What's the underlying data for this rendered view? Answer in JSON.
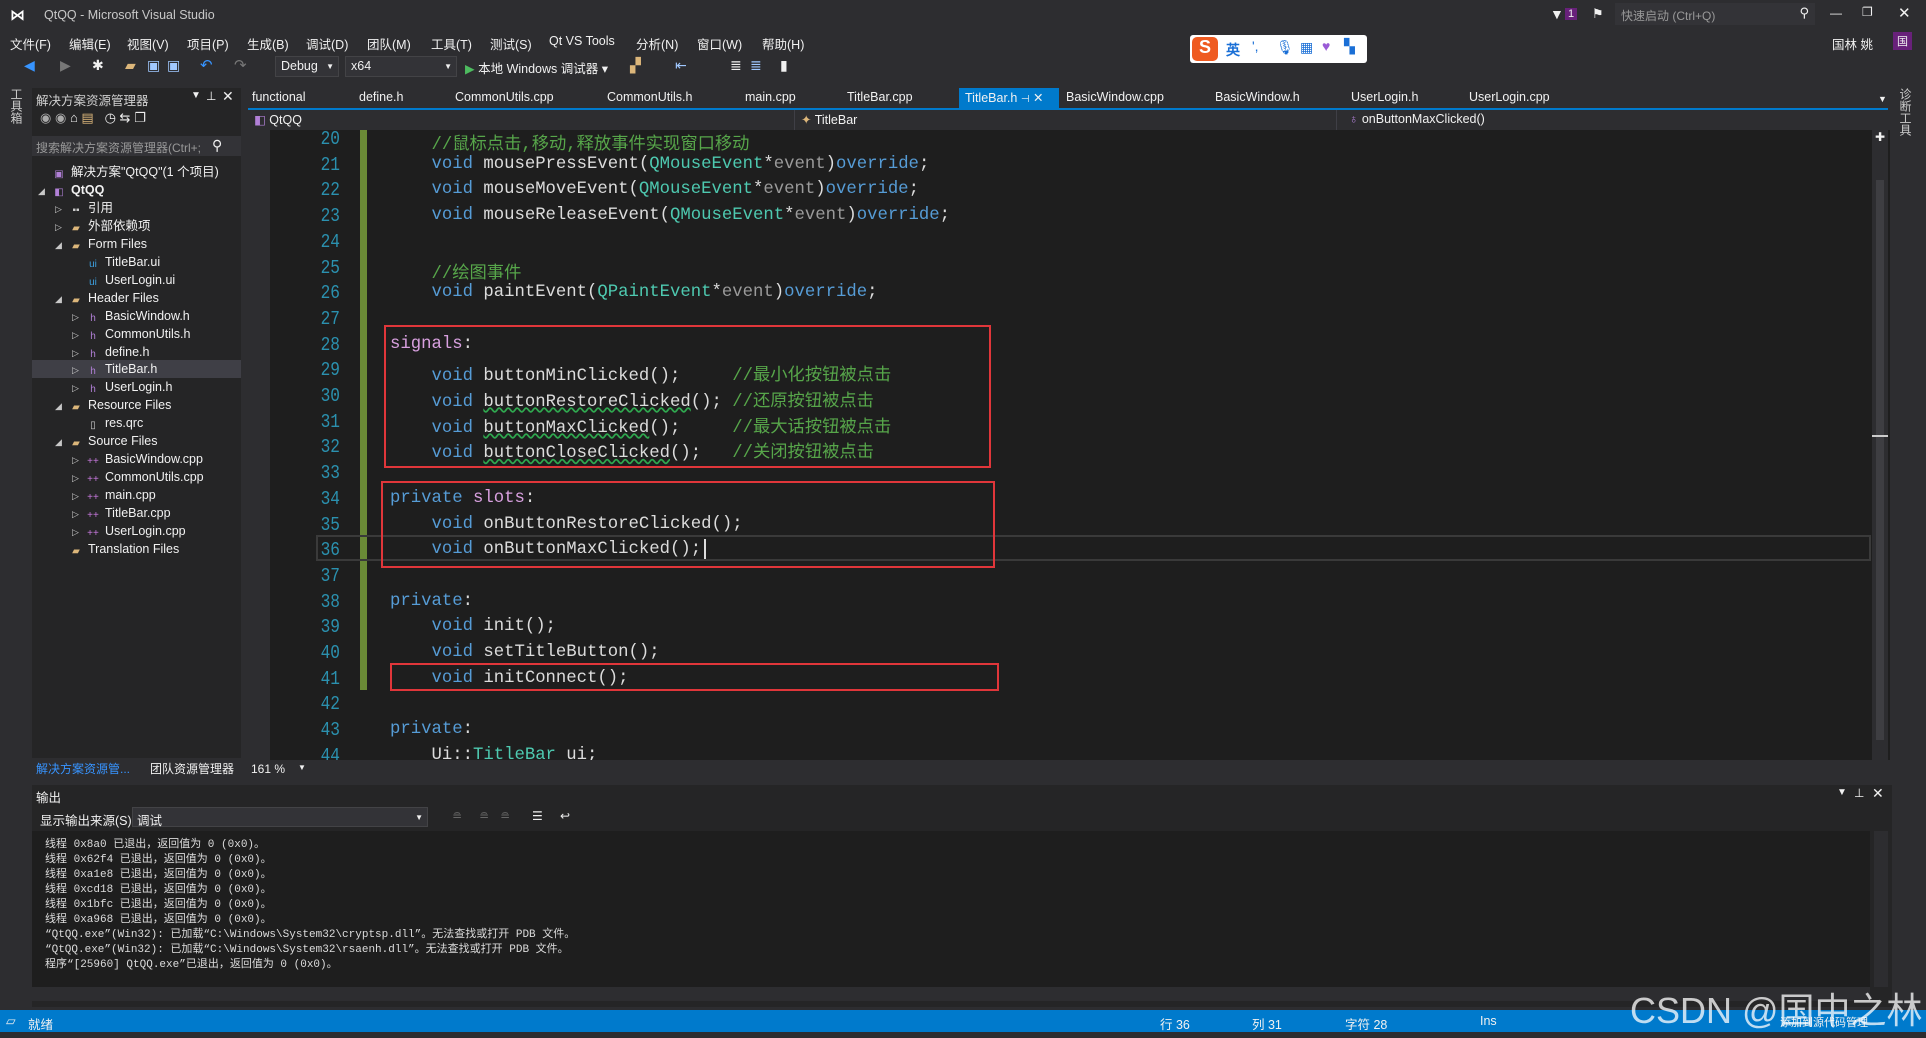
{
  "window": {
    "title": "QtQQ - Microsoft Visual Studio",
    "quick_launch": "快速启动 (Ctrl+Q)",
    "notif_count": "1",
    "user": "国林 姚",
    "user_initial": "国"
  },
  "menu": [
    "文件(F)",
    "编辑(E)",
    "视图(V)",
    "项目(P)",
    "生成(B)",
    "调试(D)",
    "团队(M)",
    "工具(T)",
    "测试(S)",
    "Qt VS Tools",
    "分析(N)",
    "窗口(W)",
    "帮助(H)"
  ],
  "toolbar": {
    "config": "Debug",
    "platform": "x64",
    "run_label": "本地 Windows 调试器"
  },
  "ime": {
    "lang": "英"
  },
  "tabs": [
    "functional",
    "define.h",
    "CommonUtils.cpp",
    "CommonUtils.h",
    "main.cpp",
    "TitleBar.cpp",
    "TitleBar.h",
    "BasicWindow.cpp",
    "BasicWindow.h",
    "UserLogin.h",
    "UserLogin.cpp"
  ],
  "active_tab": "TitleBar.h",
  "navbar": {
    "project": "QtQQ",
    "class": "TitleBar",
    "member": "onButtonMaxClicked()"
  },
  "solution_explorer": {
    "title": "解决方案资源管理器",
    "search_placeholder": "搜索解决方案资源管理器(Ctrl+;",
    "tree": [
      {
        "label": "解决方案\"QtQQ\"(1 个项目)",
        "level": 0,
        "expander": "",
        "icon": "solution"
      },
      {
        "label": "QtQQ",
        "level": 0,
        "expander": "open",
        "icon": "project",
        "bold": true
      },
      {
        "label": "引用",
        "level": 1,
        "expander": "closed",
        "icon": "references"
      },
      {
        "label": "外部依赖项",
        "level": 1,
        "expander": "closed",
        "icon": "folder"
      },
      {
        "label": "Form Files",
        "level": 1,
        "expander": "open",
        "icon": "filter"
      },
      {
        "label": "TitleBar.ui",
        "level": 2,
        "expander": "",
        "icon": "ui"
      },
      {
        "label": "UserLogin.ui",
        "level": 2,
        "expander": "",
        "icon": "ui"
      },
      {
        "label": "Header Files",
        "level": 1,
        "expander": "open",
        "icon": "filter"
      },
      {
        "label": "BasicWindow.h",
        "level": 2,
        "expander": "closed",
        "icon": "h"
      },
      {
        "label": "CommonUtils.h",
        "level": 2,
        "expander": "closed",
        "icon": "h"
      },
      {
        "label": "define.h",
        "level": 2,
        "expander": "closed",
        "icon": "h"
      },
      {
        "label": "TitleBar.h",
        "level": 2,
        "expander": "closed",
        "icon": "h",
        "selected": true
      },
      {
        "label": "UserLogin.h",
        "level": 2,
        "expander": "closed",
        "icon": "h"
      },
      {
        "label": "Resource Files",
        "level": 1,
        "expander": "open",
        "icon": "filter"
      },
      {
        "label": "res.qrc",
        "level": 2,
        "expander": "",
        "icon": "file"
      },
      {
        "label": "Source Files",
        "level": 1,
        "expander": "open",
        "icon": "filter"
      },
      {
        "label": "BasicWindow.cpp",
        "level": 2,
        "expander": "closed",
        "icon": "cpp"
      },
      {
        "label": "CommonUtils.cpp",
        "level": 2,
        "expander": "closed",
        "icon": "cpp"
      },
      {
        "label": "main.cpp",
        "level": 2,
        "expander": "closed",
        "icon": "cpp"
      },
      {
        "label": "TitleBar.cpp",
        "level": 2,
        "expander": "closed",
        "icon": "cpp"
      },
      {
        "label": "UserLogin.cpp",
        "level": 2,
        "expander": "closed",
        "icon": "cpp"
      },
      {
        "label": "Translation Files",
        "level": 1,
        "expander": "",
        "icon": "filter"
      }
    ],
    "bottom_tabs": [
      "解决方案资源管...",
      "团队资源管理器"
    ]
  },
  "left_strip": "工具箱",
  "right_strip": "诊断工具",
  "editor": {
    "zoom": "161 %",
    "first_line": 20,
    "lines": [
      [
        [
          "    ",
          ""
        ],
        [
          "//鼠标点击,移动,释放事件实现窗口移动",
          "cm"
        ]
      ],
      [
        [
          "    ",
          ""
        ],
        [
          "void",
          "kw"
        ],
        [
          " mousePressEvent(",
          ""
        ],
        [
          "QMouseEvent",
          "ty"
        ],
        [
          "*",
          ""
        ],
        [
          "event",
          "pa"
        ],
        [
          ")",
          ""
        ],
        [
          "override",
          "kw"
        ],
        [
          ";",
          ""
        ]
      ],
      [
        [
          "    ",
          ""
        ],
        [
          "void",
          "kw"
        ],
        [
          " mouseMoveEvent(",
          ""
        ],
        [
          "QMouseEvent",
          "ty"
        ],
        [
          "*",
          ""
        ],
        [
          "event",
          "pa"
        ],
        [
          ")",
          ""
        ],
        [
          "override",
          "kw"
        ],
        [
          ";",
          ""
        ]
      ],
      [
        [
          "    ",
          ""
        ],
        [
          "void",
          "kw"
        ],
        [
          " mouseReleaseEvent(",
          ""
        ],
        [
          "QMouseEvent",
          "ty"
        ],
        [
          "*",
          ""
        ],
        [
          "event",
          "pa"
        ],
        [
          ")",
          ""
        ],
        [
          "override",
          "kw"
        ],
        [
          ";",
          ""
        ]
      ],
      [],
      [
        [
          "    ",
          ""
        ],
        [
          "//绘图事件",
          "cm"
        ]
      ],
      [
        [
          "    ",
          ""
        ],
        [
          "void",
          "kw"
        ],
        [
          " paintEvent(",
          ""
        ],
        [
          "QPaintEvent",
          "ty"
        ],
        [
          "*",
          ""
        ],
        [
          "event",
          "pa"
        ],
        [
          ")",
          ""
        ],
        [
          "override",
          "kw"
        ],
        [
          ";",
          ""
        ]
      ],
      [],
      [
        [
          "signals",
          "pp"
        ],
        [
          ":",
          ""
        ]
      ],
      [
        [
          "    ",
          ""
        ],
        [
          "void",
          "kw"
        ],
        [
          " buttonMinClicked();     ",
          ""
        ],
        [
          "//最小化按钮被点击",
          "cm"
        ]
      ],
      [
        [
          "    ",
          ""
        ],
        [
          "void",
          "kw"
        ],
        [
          " ",
          ""
        ],
        [
          "buttonRestoreClicked",
          "sq"
        ],
        [
          "(); ",
          ""
        ],
        [
          "//还原按钮被点击",
          "cm"
        ]
      ],
      [
        [
          "    ",
          ""
        ],
        [
          "void",
          "kw"
        ],
        [
          " ",
          ""
        ],
        [
          "buttonMaxClicked",
          "sq"
        ],
        [
          "();     ",
          ""
        ],
        [
          "//最大话按钮被点击",
          "cm"
        ]
      ],
      [
        [
          "    ",
          ""
        ],
        [
          "void",
          "kw"
        ],
        [
          " ",
          ""
        ],
        [
          "buttonCloseClicked",
          "sq"
        ],
        [
          "();   ",
          ""
        ],
        [
          "//关闭按钮被点击",
          "cm"
        ]
      ],
      [],
      [
        [
          "private",
          "kw"
        ],
        [
          " ",
          ""
        ],
        [
          "slots",
          "pp"
        ],
        [
          ":",
          ""
        ]
      ],
      [
        [
          "    ",
          ""
        ],
        [
          "void",
          "kw"
        ],
        [
          " onButtonRestoreClicked();",
          ""
        ]
      ],
      [
        [
          "    ",
          ""
        ],
        [
          "void",
          "kw"
        ],
        [
          " onButtonMaxClicked();",
          ""
        ]
      ],
      [],
      [
        [
          "private",
          "kw"
        ],
        [
          ":",
          ""
        ]
      ],
      [
        [
          "    ",
          ""
        ],
        [
          "void",
          "kw"
        ],
        [
          " init();",
          ""
        ]
      ],
      [
        [
          "    ",
          ""
        ],
        [
          "void",
          "kw"
        ],
        [
          " setTitleButton();",
          ""
        ]
      ],
      [
        [
          "    ",
          ""
        ],
        [
          "void",
          "kw"
        ],
        [
          " initConnect();",
          ""
        ]
      ],
      [],
      [
        [
          "private",
          "kw"
        ],
        [
          ":",
          ""
        ]
      ],
      [
        [
          "    ",
          ""
        ],
        [
          "Ui::",
          ""
        ],
        [
          "TitleBar",
          "ty"
        ],
        [
          " ui;",
          ""
        ]
      ]
    ]
  },
  "output": {
    "title": "输出",
    "source_label": "显示输出来源(S):",
    "source_value": "调试",
    "lines": [
      "线程 0x8a0 已退出，返回值为 0 (0x0)。",
      "线程 0x62f4 已退出，返回值为 0 (0x0)。",
      "线程 0xa1e8 已退出，返回值为 0 (0x0)。",
      "线程 0xcd18 已退出，返回值为 0 (0x0)。",
      "线程 0x1bfc 已退出，返回值为 0 (0x0)。",
      "线程 0xa968 已退出，返回值为 0 (0x0)。",
      "“QtQQ.exe”(Win32): 已加载“C:\\Windows\\System32\\cryptsp.dll”。无法查找或打开 PDB 文件。",
      "“QtQQ.exe”(Win32): 已加载“C:\\Windows\\System32\\rsaenh.dll”。无法查找或打开 PDB 文件。",
      "程序“[25960] QtQQ.exe”已退出，返回值为 0 (0x0)。"
    ]
  },
  "status": {
    "ready": "就绪",
    "row": "行 36",
    "col": "列 31",
    "char": "字符 28",
    "mode": "Ins",
    "source_control": "添加到源代码管理"
  },
  "watermark": "CSDN @国中之林",
  "colors": {
    "accent": "#007acc",
    "highlight_box": "#e0363a",
    "keyword": "#569cd6",
    "type": "#4ec9b0",
    "comment": "#57a64a"
  }
}
